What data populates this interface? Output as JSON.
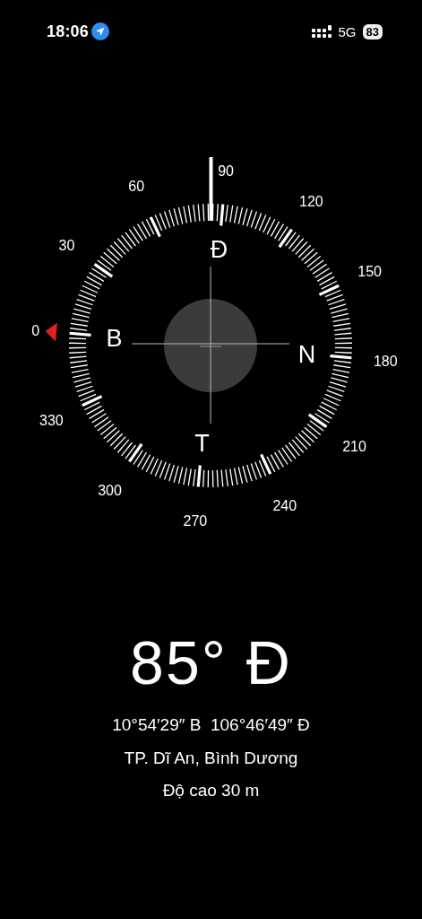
{
  "status_bar": {
    "time": "18:06",
    "network": "5G",
    "battery": "83"
  },
  "compass": {
    "dial_labels": [
      "0",
      "30",
      "60",
      "90",
      "120",
      "150",
      "180",
      "210",
      "240",
      "270",
      "300",
      "330"
    ],
    "cardinals": [
      "B",
      "Đ",
      "N",
      "T"
    ]
  },
  "heading": "85° Đ",
  "coordinates": "10°54′29″ B  106°46′49″ Đ",
  "location": "TP. Dĩ An, Bình Dương",
  "altitude": "Độ cao 30 m"
}
